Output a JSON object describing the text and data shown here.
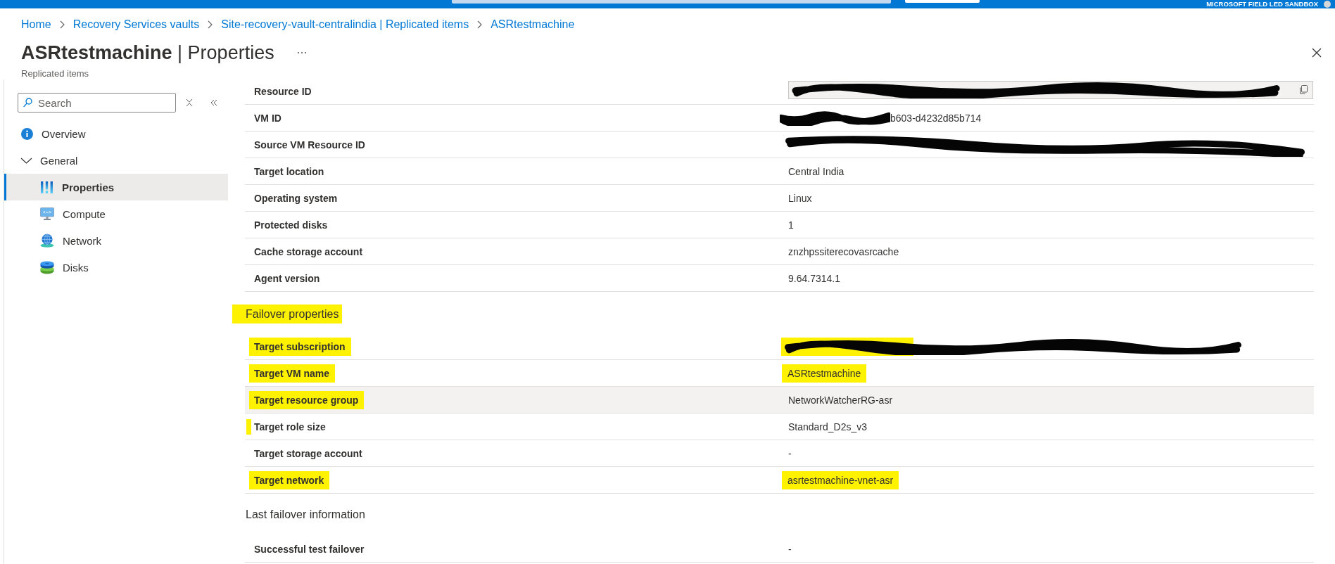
{
  "top_bar": {
    "account": "MICROSOFT FIELD LED SANDBOX"
  },
  "breadcrumb": [
    {
      "label": "Home"
    },
    {
      "label": "Recovery Services vaults"
    },
    {
      "label": "Site-recovery-vault-centralindia | Replicated items"
    },
    {
      "label": "ASRtestmachine"
    }
  ],
  "header": {
    "title": "**ASRtestmachine** | Properties",
    "subtitle": "Replicated items"
  },
  "sidebar": {
    "search": {
      "placeholder": "Search"
    },
    "items": [
      {
        "label": "Overview",
        "kind": "link",
        "selected": false
      },
      {
        "label": "General",
        "kind": "group",
        "expanded": true,
        "selected": false,
        "children": [
          {
            "label": "Properties",
            "selected": true
          },
          {
            "label": "Compute",
            "selected": false
          },
          {
            "label": "Network",
            "selected": false
          },
          {
            "label": "Disks",
            "selected": false
          }
        ]
      }
    ]
  },
  "sections": [
    {
      "rows": [
        {
          "label": "Resource ID",
          "kind": "field",
          "redacted": true
        },
        {
          "label": "VM ID",
          "kind": "text",
          "redacted": true,
          "value": "b603-d4232d85b714"
        },
        {
          "label": "Source VM Resource ID",
          "kind": "text",
          "redacted": true
        },
        {
          "label": "Target location",
          "kind": "text",
          "redacted": false,
          "value": "Central India"
        },
        {
          "label": "Operating system",
          "kind": "text",
          "redacted": false,
          "value": "Linux"
        },
        {
          "label": "Protected disks",
          "kind": "text",
          "redacted": false,
          "value": "1"
        },
        {
          "label": "Cache storage account",
          "kind": "text",
          "redacted": false,
          "value": "znzhpssiterecovasrcache"
        },
        {
          "label": "Agent version",
          "kind": "text",
          "redacted": false,
          "value": "9.64.7314.1"
        }
      ]
    },
    {
      "heading": "Failover properties",
      "heading_highlighted": true,
      "rows": [
        {
          "label": "Target subscription",
          "kind": "text",
          "redacted": true,
          "label_highlighted": true,
          "edge_mark": false,
          "value_highlighted": true,
          "hovered": false
        },
        {
          "label": "Target VM name",
          "kind": "text",
          "redacted": false,
          "value": "ASRtestmachine",
          "label_highlighted": true,
          "edge_mark": false,
          "value_highlighted": true,
          "hovered": false
        },
        {
          "label": "Target resource group",
          "kind": "text",
          "redacted": false,
          "value": "NetworkWatcherRG-asr",
          "label_highlighted": true,
          "edge_mark": false,
          "value_highlighted": false,
          "hovered": true
        },
        {
          "label": "Target role size",
          "kind": "text",
          "redacted": false,
          "value": "Standard_D2s_v3",
          "label_highlighted": false,
          "edge_mark": true,
          "value_highlighted": false,
          "hovered": false
        },
        {
          "label": "Target storage account",
          "kind": "text",
          "redacted": false,
          "value": "-",
          "label_highlighted": false,
          "edge_mark": false,
          "value_highlighted": false,
          "hovered": false
        },
        {
          "label": "Target network",
          "kind": "text",
          "redacted": false,
          "value": "asrtestmachine-vnet-asr",
          "label_highlighted": true,
          "edge_mark": false,
          "value_highlighted": true,
          "hovered": false
        }
      ]
    },
    {
      "heading": "Last failover information",
      "heading_highlighted": false,
      "rows": [
        {
          "label": "Successful test failover",
          "kind": "text",
          "redacted": false,
          "value": "-"
        }
      ]
    }
  ]
}
